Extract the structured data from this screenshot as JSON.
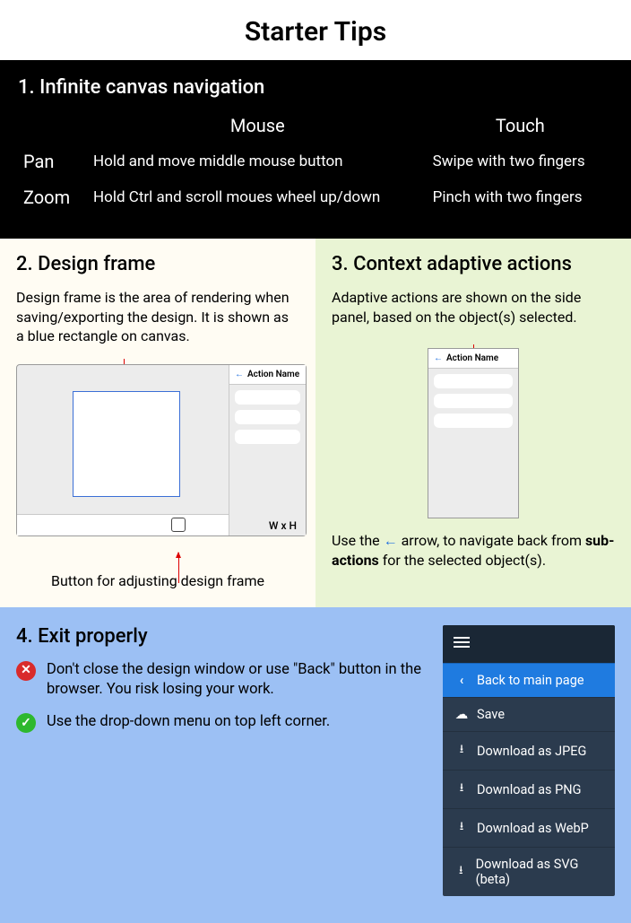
{
  "title": "Starter Tips",
  "section1": {
    "heading": "1. Infinite canvas navigation",
    "col_mouse": "Mouse",
    "col_touch": "Touch",
    "row_pan": "Pan",
    "row_zoom": "Zoom",
    "pan_mouse": "Hold and move middle mouse button",
    "pan_touch": "Swipe with two fingers",
    "zoom_mouse": "Hold Ctrl and scroll moues wheel up/down",
    "zoom_touch": "Pinch with two fingers"
  },
  "section2": {
    "heading": "2. Design frame",
    "body": "Design frame is the area of rendering when saving/exporting the design. It is shown as a blue rectangle on canvas.",
    "sidebar_title": "Action Name",
    "wh_label": "W x H",
    "caption": "Button for adjusting design frame"
  },
  "section3": {
    "heading": "3. Context adaptive actions",
    "body": "Adaptive actions are shown on the side panel, based on the object(s) selected.",
    "panel_title": "Action Name",
    "footer_pre": "Use the ",
    "footer_arrow": "←",
    "footer_mid": " arrow, to navigate back from ",
    "footer_bold": "sub-actions",
    "footer_post": "  for the selected object(s)."
  },
  "section4": {
    "heading": "4. Exit properly",
    "dont": "Don't close the design window or use \"Back\" button in the browser. You risk losing your work.",
    "do": "Use the drop-down menu on top left corner.",
    "menu": {
      "back": "Back to main page",
      "save": "Save",
      "jpeg": "Download as JPEG",
      "png": "Download as PNG",
      "webp": "Download as WebP",
      "svg": "Download as SVG (beta)"
    }
  }
}
